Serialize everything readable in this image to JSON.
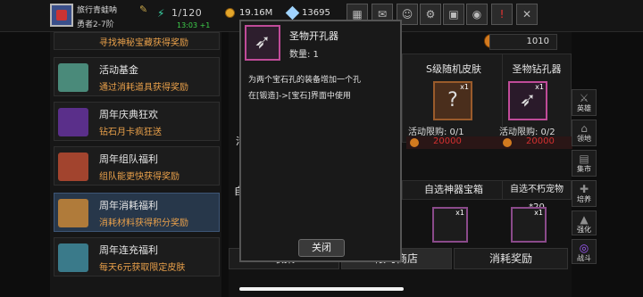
{
  "topbar": {
    "player_name": "旅行青蛙呐",
    "player_rank": "勇者2-7阶",
    "energy": "1/120",
    "energy_timer": "13:03 +1",
    "gold": "19.16M",
    "gems": "13695"
  },
  "left_list": [
    {
      "title": "",
      "desc": "寻找神秘宝藏获得奖励",
      "icon_color": "#b0702a"
    },
    {
      "title": "活动基金",
      "desc": "通过消耗道具获得奖励",
      "icon_color": "#4a8a7a"
    },
    {
      "title": "周年庆典狂欢",
      "desc": "钻石月卡疯狂送",
      "icon_color": "#5a2f8a"
    },
    {
      "title": "周年组队福利",
      "desc": "组队能更快获得奖励",
      "icon_color": "#a2442e"
    },
    {
      "title": "周年消耗福利",
      "desc": "消耗材料获得积分奖励",
      "icon_color": "#b07b3a"
    },
    {
      "title": "周年连充福利",
      "desc": "每天6元获取限定皮肤",
      "icon_color": "#3a7a8a"
    }
  ],
  "shop": {
    "currency": "1010",
    "cards": [
      {
        "title": "S级随机皮肤",
        "qty": "x1",
        "limit": "活动限购: 0/1",
        "price": "20000"
      },
      {
        "title": "圣物钻孔器",
        "qty": "x1",
        "limit": "活动限购: 0/2",
        "price": "20000"
      }
    ],
    "row2": [
      {
        "title": "自选神器宝箱",
        "qty": "x1"
      },
      {
        "title": "自选不朽宠物*20",
        "qty": "x1"
      }
    ],
    "partial_left_1": "活",
    "partial_left_2": "自",
    "tabs": [
      "收集",
      "限时商店",
      "消耗奖励"
    ]
  },
  "sidebar": [
    "英雄",
    "领地",
    "集市",
    "培养",
    "强化",
    "培养",
    "战斗"
  ],
  "popup": {
    "title": "圣物开孔器",
    "qty": "数量: 1",
    "desc1": "为两个宝石孔的装备增加一个孔",
    "desc2": "在[锻造]->[宝石]界面中使用",
    "close": "关闭"
  },
  "colors": {
    "accent_orange": "#e9a04a",
    "price_red": "#d43030",
    "relic_border": "#c04b99"
  }
}
